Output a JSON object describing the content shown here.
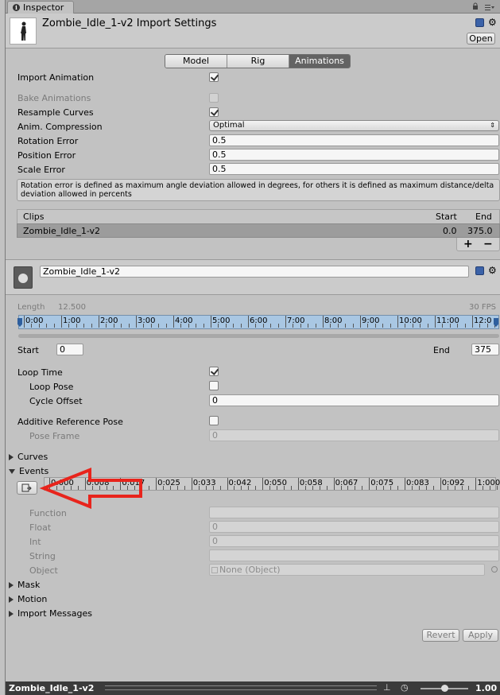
{
  "tab": {
    "label": "Inspector"
  },
  "header": {
    "title": "Zombie_Idle_1-v2 Import Settings",
    "open_label": "Open"
  },
  "segments": [
    "Model",
    "Rig",
    "Animations"
  ],
  "settings": {
    "import_animation": {
      "label": "Import Animation",
      "checked": true
    },
    "bake_animations": {
      "label": "Bake Animations",
      "checked": false
    },
    "resample_curves": {
      "label": "Resample Curves",
      "checked": true
    },
    "anim_compression": {
      "label": "Anim. Compression",
      "value": "Optimal"
    },
    "rotation_error": {
      "label": "Rotation Error",
      "value": "0.5"
    },
    "position_error": {
      "label": "Position Error",
      "value": "0.5"
    },
    "scale_error": {
      "label": "Scale Error",
      "value": "0.5"
    }
  },
  "help_text": "Rotation error is defined as maximum angle deviation allowed in degrees, for others it is defined as maximum distance/delta deviation allowed in percents",
  "clips": {
    "headers": {
      "name": "Clips",
      "start": "Start",
      "end": "End"
    },
    "rows": [
      {
        "name": "Zombie_Idle_1-v2",
        "start": "0.0",
        "end": "375.0"
      }
    ],
    "add": "+",
    "remove": "−"
  },
  "clip": {
    "name": "Zombie_Idle_1-v2",
    "length_label": "Length",
    "length_value": "12.500",
    "fps": "30 FPS",
    "ticks": [
      "0:00",
      "1:00",
      "2:00",
      "3:00",
      "4:00",
      "5:00",
      "6:00",
      "7:00",
      "8:00",
      "9:00",
      "10:00",
      "11:00",
      "12:0"
    ],
    "start_label": "Start",
    "start_value": "0",
    "end_label": "End",
    "end_value": "375"
  },
  "loop": {
    "loop_time": {
      "label": "Loop Time",
      "checked": true
    },
    "loop_pose": {
      "label": "Loop Pose",
      "checked": false
    },
    "cycle_offset": {
      "label": "Cycle Offset",
      "value": "0"
    },
    "additive": {
      "label": "Additive Reference Pose",
      "checked": false
    },
    "pose_frame": {
      "label": "Pose Frame",
      "value": "0"
    }
  },
  "foldouts": {
    "curves": "Curves",
    "events": "Events",
    "mask": "Mask",
    "motion": "Motion",
    "import_messages": "Import Messages"
  },
  "events": {
    "ticks": [
      "0:000",
      "0:008",
      "0:017",
      "0:025",
      "0:033",
      "0:042",
      "0:050",
      "0:058",
      "0:067",
      "0:075",
      "0:083",
      "0:092",
      "1:000"
    ],
    "function": {
      "label": "Function",
      "value": ""
    },
    "float": {
      "label": "Float",
      "value": "0"
    },
    "int": {
      "label": "Int",
      "value": "0"
    },
    "string": {
      "label": "String",
      "value": ""
    },
    "object": {
      "label": "Object",
      "value": "None (Object)"
    }
  },
  "buttons": {
    "revert": "Revert",
    "apply": "Apply"
  },
  "status": {
    "name": "Zombie_Idle_1-v2",
    "speed": "1.00"
  },
  "colors": {
    "arrow": "#e8241c",
    "timeline": "#a9c7e3",
    "status_bar": "#3b3b3b"
  }
}
